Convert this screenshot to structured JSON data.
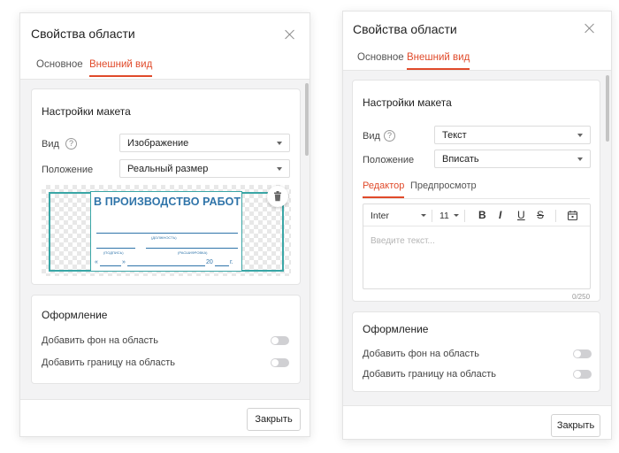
{
  "left": {
    "title": "Свойства области",
    "tabs": [
      "Основное",
      "Внешний вид"
    ],
    "layout_section": "Настройки макета",
    "view_label": "Вид",
    "view_value": "Изображение",
    "position_label": "Положение",
    "position_value": "Реальный размер",
    "image": {
      "heading": "В ПРОИЗВОДСТВО РАБОТ",
      "position_caption": "(ДОЛЖНОСТЬ)",
      "signature_caption": "(ПОДПИСЬ)",
      "decoding_caption": "(РАСШИФРОВКА)",
      "date_open": "«",
      "date_close": "»",
      "year_prefix": "20",
      "year_suffix": "г."
    },
    "design_section": "Оформление",
    "bg_toggle_label": "Добавить фон на область",
    "border_toggle_label": "Добавить границу на область",
    "close_button": "Закрыть"
  },
  "right": {
    "title": "Свойства области",
    "tabs": [
      "Основное",
      "Внешний вид"
    ],
    "layout_section": "Настройки макета",
    "view_label": "Вид",
    "view_value": "Текст",
    "position_label": "Положение",
    "position_value": "Вписать",
    "subtabs": [
      "Редактор",
      "Предпросмотр"
    ],
    "font_family": "Inter",
    "font_size": "11",
    "placeholder": "Введите текст...",
    "counter": "0/250",
    "design_section": "Оформление",
    "bg_toggle_label": "Добавить фон на область",
    "border_toggle_label": "Добавить границу на область",
    "close_button": "Закрыть"
  },
  "icons": {
    "close": "close-icon",
    "help": "help-circle-icon",
    "chevron": "chevron-down-icon",
    "trash": "trash-icon",
    "bold": "bold-icon",
    "italic": "italic-icon",
    "underline": "underline-icon",
    "strike": "strikethrough-icon",
    "calendar": "calendar-icon"
  },
  "colors": {
    "accent": "#e04a2a",
    "stamp_blue": "#2f74a9",
    "image_frame": "#3aa6a6"
  }
}
